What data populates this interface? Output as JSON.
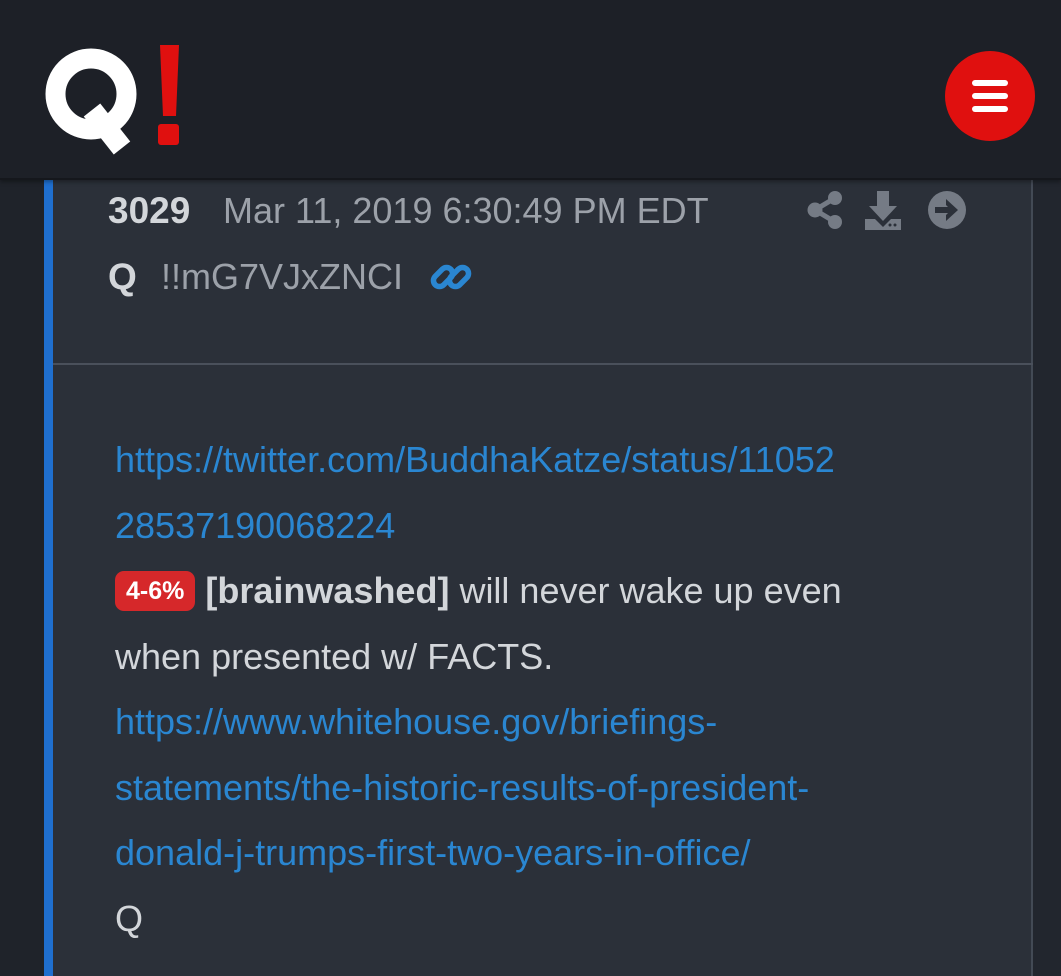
{
  "header": {
    "logo_text": "Q!",
    "menu_icon": "hamburger-menu-icon",
    "brand_color": "#e0100f"
  },
  "post": {
    "number": "3029",
    "date": "Mar 11, 2019 6:30:49 PM EDT",
    "author": "Q",
    "tripcode": "!!mG7VJxZNCI",
    "actions": [
      "share-icon",
      "download-icon",
      "arrow-right-icon",
      "link-icon"
    ],
    "body": {
      "link1_line1": "https://twitter.com/BuddhaKatze/status/11052",
      "link1_line2": "28537190068224",
      "badge": "4-6%",
      "bold_text": "[brainwashed]",
      "text_line1_rest": " will never wake up even",
      "text_line2": "when presented w/ FACTS.",
      "link2_line1": "https://www.whitehouse.gov/briefings-",
      "link2_line2": "statements/the-historic-results-of-president-",
      "link2_line3": "donald-j-trumps-first-two-years-in-office/",
      "signature": "Q"
    }
  },
  "colors": {
    "link": "#2a86d1",
    "badge": "#d6282a",
    "accent_bar": "#1f6fcf"
  }
}
